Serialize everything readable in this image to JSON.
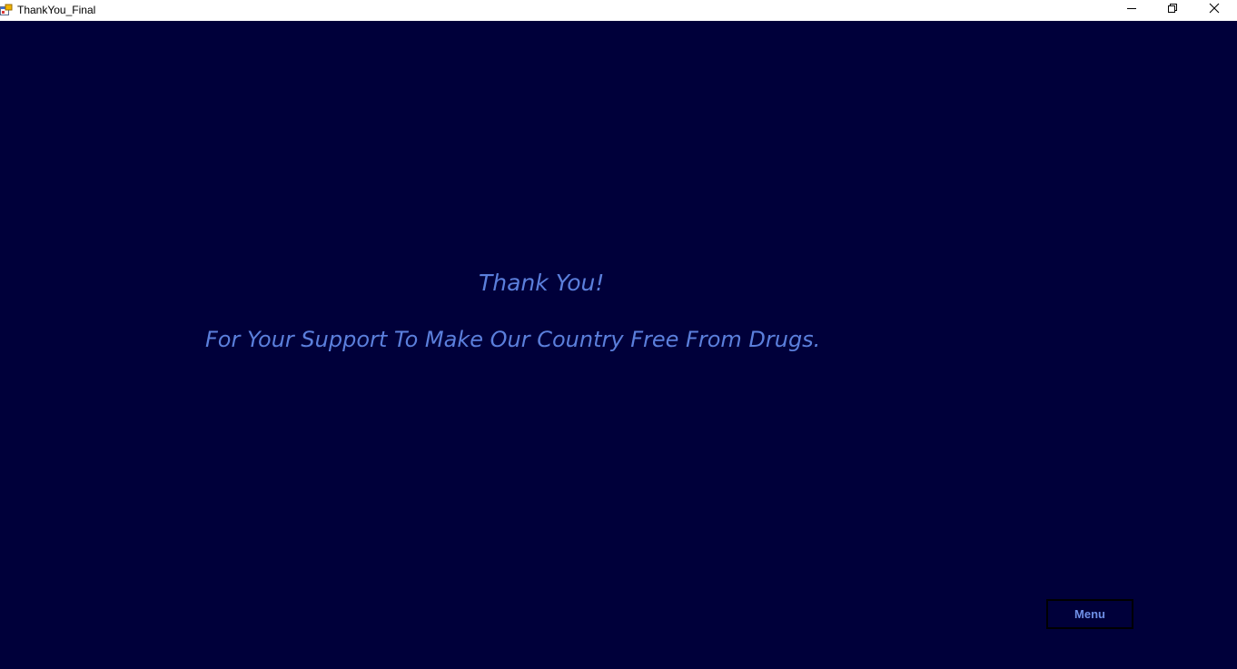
{
  "window": {
    "title": "ThankYou_Final"
  },
  "icons": {
    "app": "app-form-icon",
    "minimize": "minimize-icon",
    "maximize": "restore-icon",
    "close": "close-icon"
  },
  "main": {
    "heading": "Thank You!",
    "message": "For Your Support To Make Our Country Free From Drugs.",
    "menu_button": "Menu"
  },
  "colors": {
    "background": "#00003a",
    "text": "#5b7fdc",
    "button_text": "#6f8fe6"
  }
}
